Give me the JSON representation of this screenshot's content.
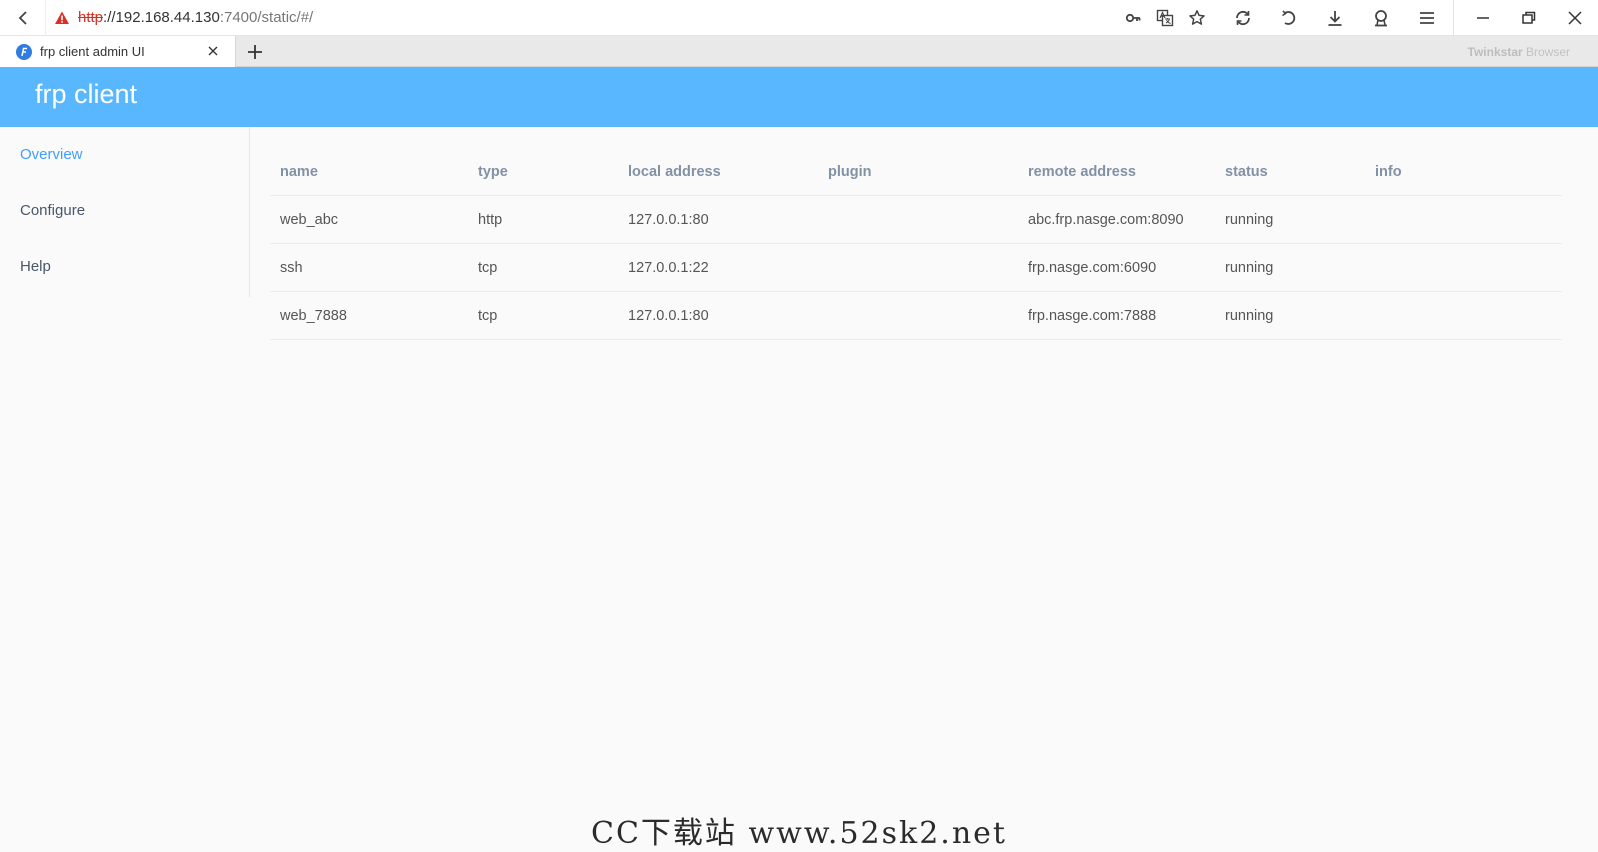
{
  "browser": {
    "url_scheme": "http",
    "url_sep": "://",
    "url_host": "192.168.44.130",
    "url_rest": ":7400/static/#/",
    "tab_title": "frp client admin UI",
    "brand_bold": "Twinkstar",
    "brand_light": " Browser"
  },
  "app": {
    "title": "frp client"
  },
  "sidebar": {
    "items": [
      {
        "label": "Overview",
        "active": true
      },
      {
        "label": "Configure",
        "active": false
      },
      {
        "label": "Help",
        "active": false
      }
    ]
  },
  "table": {
    "headers": [
      "name",
      "type",
      "local address",
      "plugin",
      "remote address",
      "status",
      "info"
    ],
    "rows": [
      [
        "web_abc",
        "http",
        "127.0.0.1:80",
        "",
        "abc.frp.nasge.com:8090",
        "running",
        ""
      ],
      [
        "ssh",
        "tcp",
        "127.0.0.1:22",
        "",
        "frp.nasge.com:6090",
        "running",
        ""
      ],
      [
        "web_7888",
        "tcp",
        "127.0.0.1:80",
        "",
        "frp.nasge.com:7888",
        "running",
        ""
      ]
    ]
  },
  "watermark": "CC下载站 www.52sk2.net",
  "colors": {
    "header": "#58b7ff",
    "active_menu": "#409eff",
    "warning": "#d93025"
  },
  "icons": [
    "back-icon",
    "warning-icon",
    "key-icon",
    "translate-icon",
    "star-icon",
    "refresh-icon",
    "undo-icon",
    "download-icon",
    "user-icon",
    "menu-icon",
    "minimize-icon",
    "restore-icon",
    "window-close-icon",
    "favicon-icon",
    "tab-close-icon",
    "plus-icon"
  ]
}
